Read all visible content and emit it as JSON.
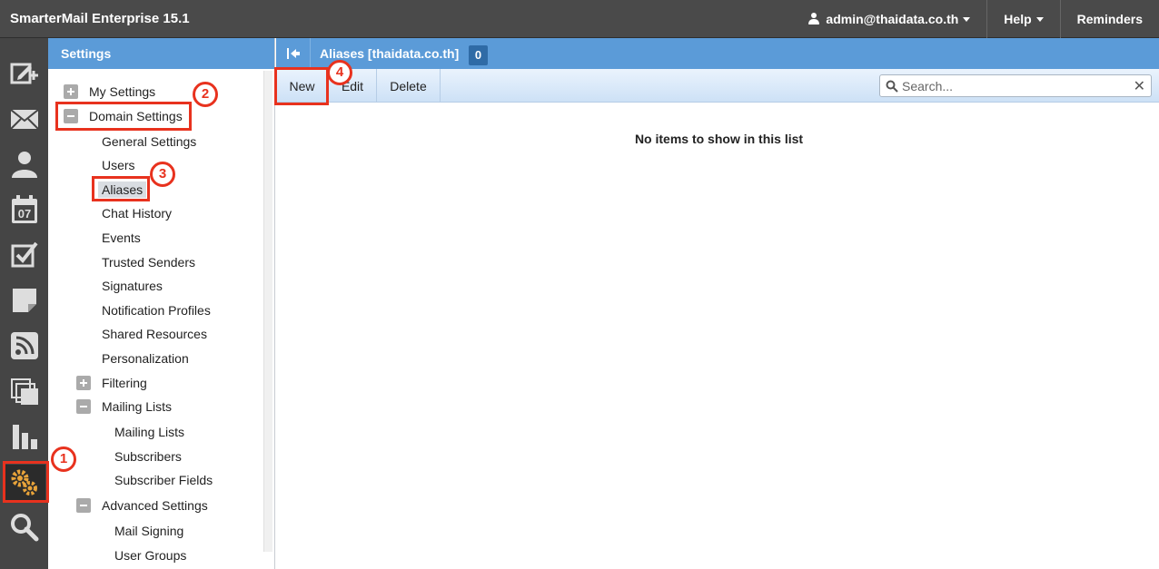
{
  "app": {
    "title": "SmarterMail Enterprise 15.1"
  },
  "topbar": {
    "user": "admin@thaidata.co.th",
    "help": "Help",
    "reminders": "Reminders"
  },
  "rail": {
    "icons": [
      "compose-icon",
      "mail-icon",
      "contacts-icon",
      "calendar-icon",
      "tasks-icon",
      "notes-icon",
      "rss-icon",
      "files-icon",
      "reports-icon",
      "settings-icon",
      "search-icon"
    ],
    "calendar_day": "07",
    "active": "settings-icon"
  },
  "tree": {
    "header": "Settings",
    "my_settings": "My Settings",
    "domain_settings": "Domain Settings",
    "domain_children": [
      "General Settings",
      "Users",
      "Aliases",
      "Chat History",
      "Events",
      "Trusted Senders",
      "Signatures",
      "Notification Profiles",
      "Shared Resources",
      "Personalization"
    ],
    "filtering": "Filtering",
    "mailing_lists": "Mailing Lists",
    "mailing_children": [
      "Mailing Lists",
      "Subscribers",
      "Subscriber Fields"
    ],
    "advanced_settings": "Advanced Settings",
    "advanced_children": [
      "Mail Signing",
      "User Groups"
    ],
    "selected": "Aliases"
  },
  "main": {
    "title": "Aliases [thaidata.co.th]",
    "count": "0",
    "toolbar": {
      "new": "New",
      "edit": "Edit",
      "delete": "Delete"
    },
    "search_placeholder": "Search...",
    "empty_message": "No items to show in this list"
  },
  "annotations": {
    "steps": [
      "1",
      "2",
      "3",
      "4"
    ],
    "color": "#e8321e"
  },
  "colors": {
    "header_blue": "#5b9bd8",
    "topbar": "#4a4a4a",
    "rail": "#454545",
    "settings_gear": "#e8a33a"
  }
}
